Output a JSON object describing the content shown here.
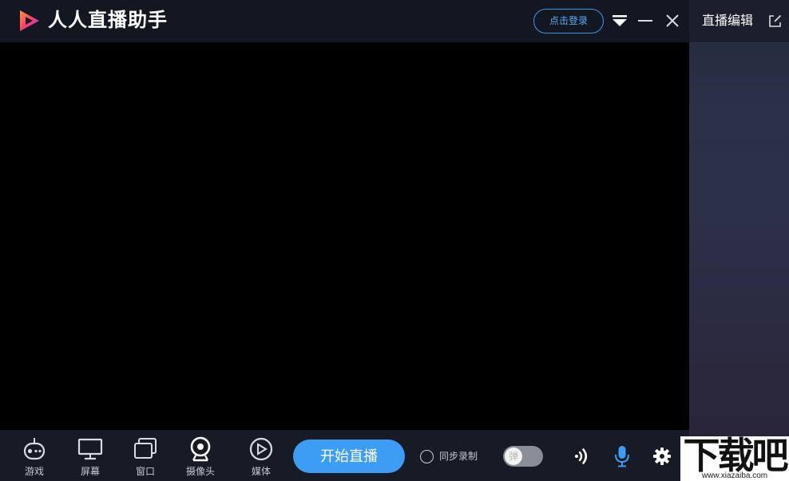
{
  "app": {
    "title": "人人直播助手"
  },
  "titlebar": {
    "login_label": "点击登录"
  },
  "side_panel": {
    "title": "直播编辑"
  },
  "sources": [
    {
      "label": "游戏",
      "icon": "gamepad-icon"
    },
    {
      "label": "屏幕",
      "icon": "monitor-icon"
    },
    {
      "label": "窗口",
      "icon": "window-icon"
    },
    {
      "label": "摄像头",
      "icon": "camera-icon"
    },
    {
      "label": "媒体",
      "icon": "media-play-icon"
    }
  ],
  "controls": {
    "start_label": "开始直播",
    "sync_record_label": "同步录制",
    "sync_record_checked": false,
    "danmaku_toggle_label": "弹",
    "danmaku_toggle_on": false
  },
  "watermark": {
    "main": "下载吧",
    "url": "www.xiazaiba.com"
  },
  "colors": {
    "accent": "#3d9df4",
    "titlebar_bg": "#131722",
    "preview_bg": "#000000"
  }
}
